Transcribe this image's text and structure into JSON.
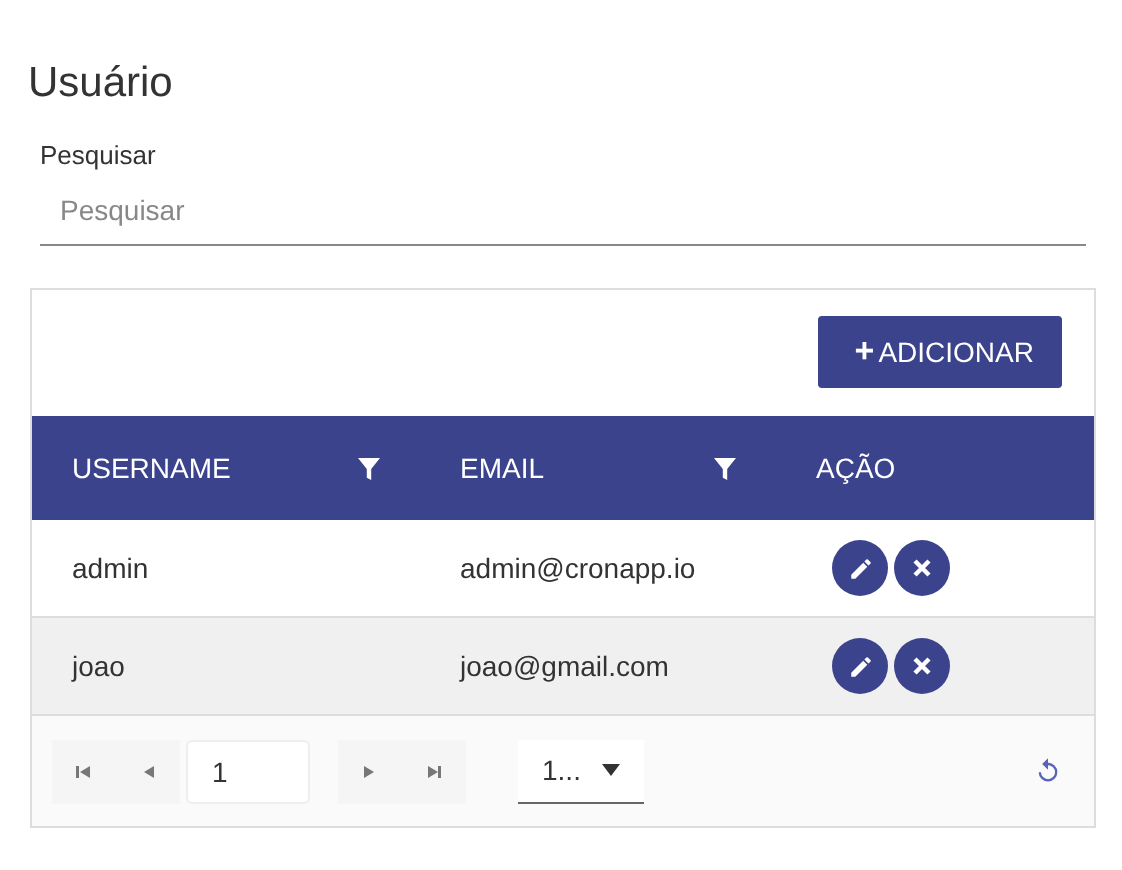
{
  "title": "Usuário",
  "search": {
    "label": "Pesquisar",
    "placeholder": "Pesquisar"
  },
  "add_button": {
    "icon": "+",
    "label": "ADICIONAR"
  },
  "table": {
    "columns": [
      {
        "label": "USERNAME",
        "filter": true
      },
      {
        "label": "EMAIL",
        "filter": true
      },
      {
        "label": "AÇÃO",
        "filter": false
      }
    ],
    "rows": [
      {
        "username": "admin",
        "email": "admin@cronapp.io"
      },
      {
        "username": "joao",
        "email": "joao@gmail.com"
      }
    ]
  },
  "pager": {
    "page": "1",
    "page_size": "1..."
  }
}
